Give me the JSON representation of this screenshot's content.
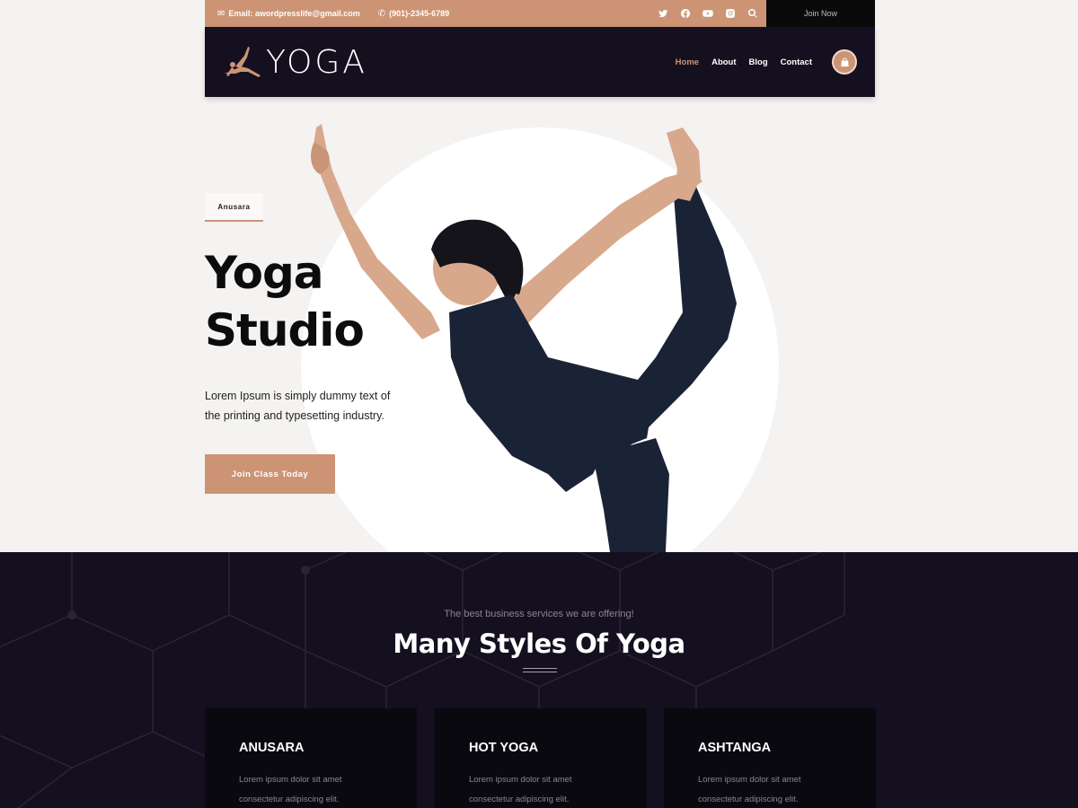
{
  "topbar": {
    "email": "Email: awordpresslife@gmail.com",
    "phone": "(901)-2345-6789",
    "socials": [
      "twitter-icon",
      "facebook-icon",
      "youtube-icon",
      "instagram-icon",
      "search-icon"
    ],
    "join_now": "Join Now"
  },
  "header": {
    "logo_text": "YOGA",
    "nav": [
      {
        "label": "Home",
        "active": true
      },
      {
        "label": "About",
        "active": false
      },
      {
        "label": "Blog",
        "active": false
      },
      {
        "label": "Contact",
        "active": false
      }
    ],
    "cart_icon": "shopping-bag-icon"
  },
  "hero": {
    "tag": "Anusara",
    "title_line1": "Yoga",
    "title_line2": "Studio",
    "description": "Lorem Ipsum is simply dummy text of the printing and typesetting industry.",
    "button": "Join Class Today"
  },
  "services": {
    "subtitle": "The best business services we are offering!",
    "title": "Many Styles Of Yoga",
    "cards": [
      {
        "title": "ANUSARA",
        "text": "Lorem ipsum dolor sit amet consectetur adipiscing elit."
      },
      {
        "title": "HOT YOGA",
        "text": "Lorem ipsum dolor sit amet consectetur adipiscing elit."
      },
      {
        "title": "ASHTANGA",
        "text": "Lorem ipsum dolor sit amet consectetur adipiscing elit."
      }
    ]
  },
  "colors": {
    "accent": "#cc9475",
    "dark": "#15101f",
    "hero_bg": "#f4f3f1"
  }
}
